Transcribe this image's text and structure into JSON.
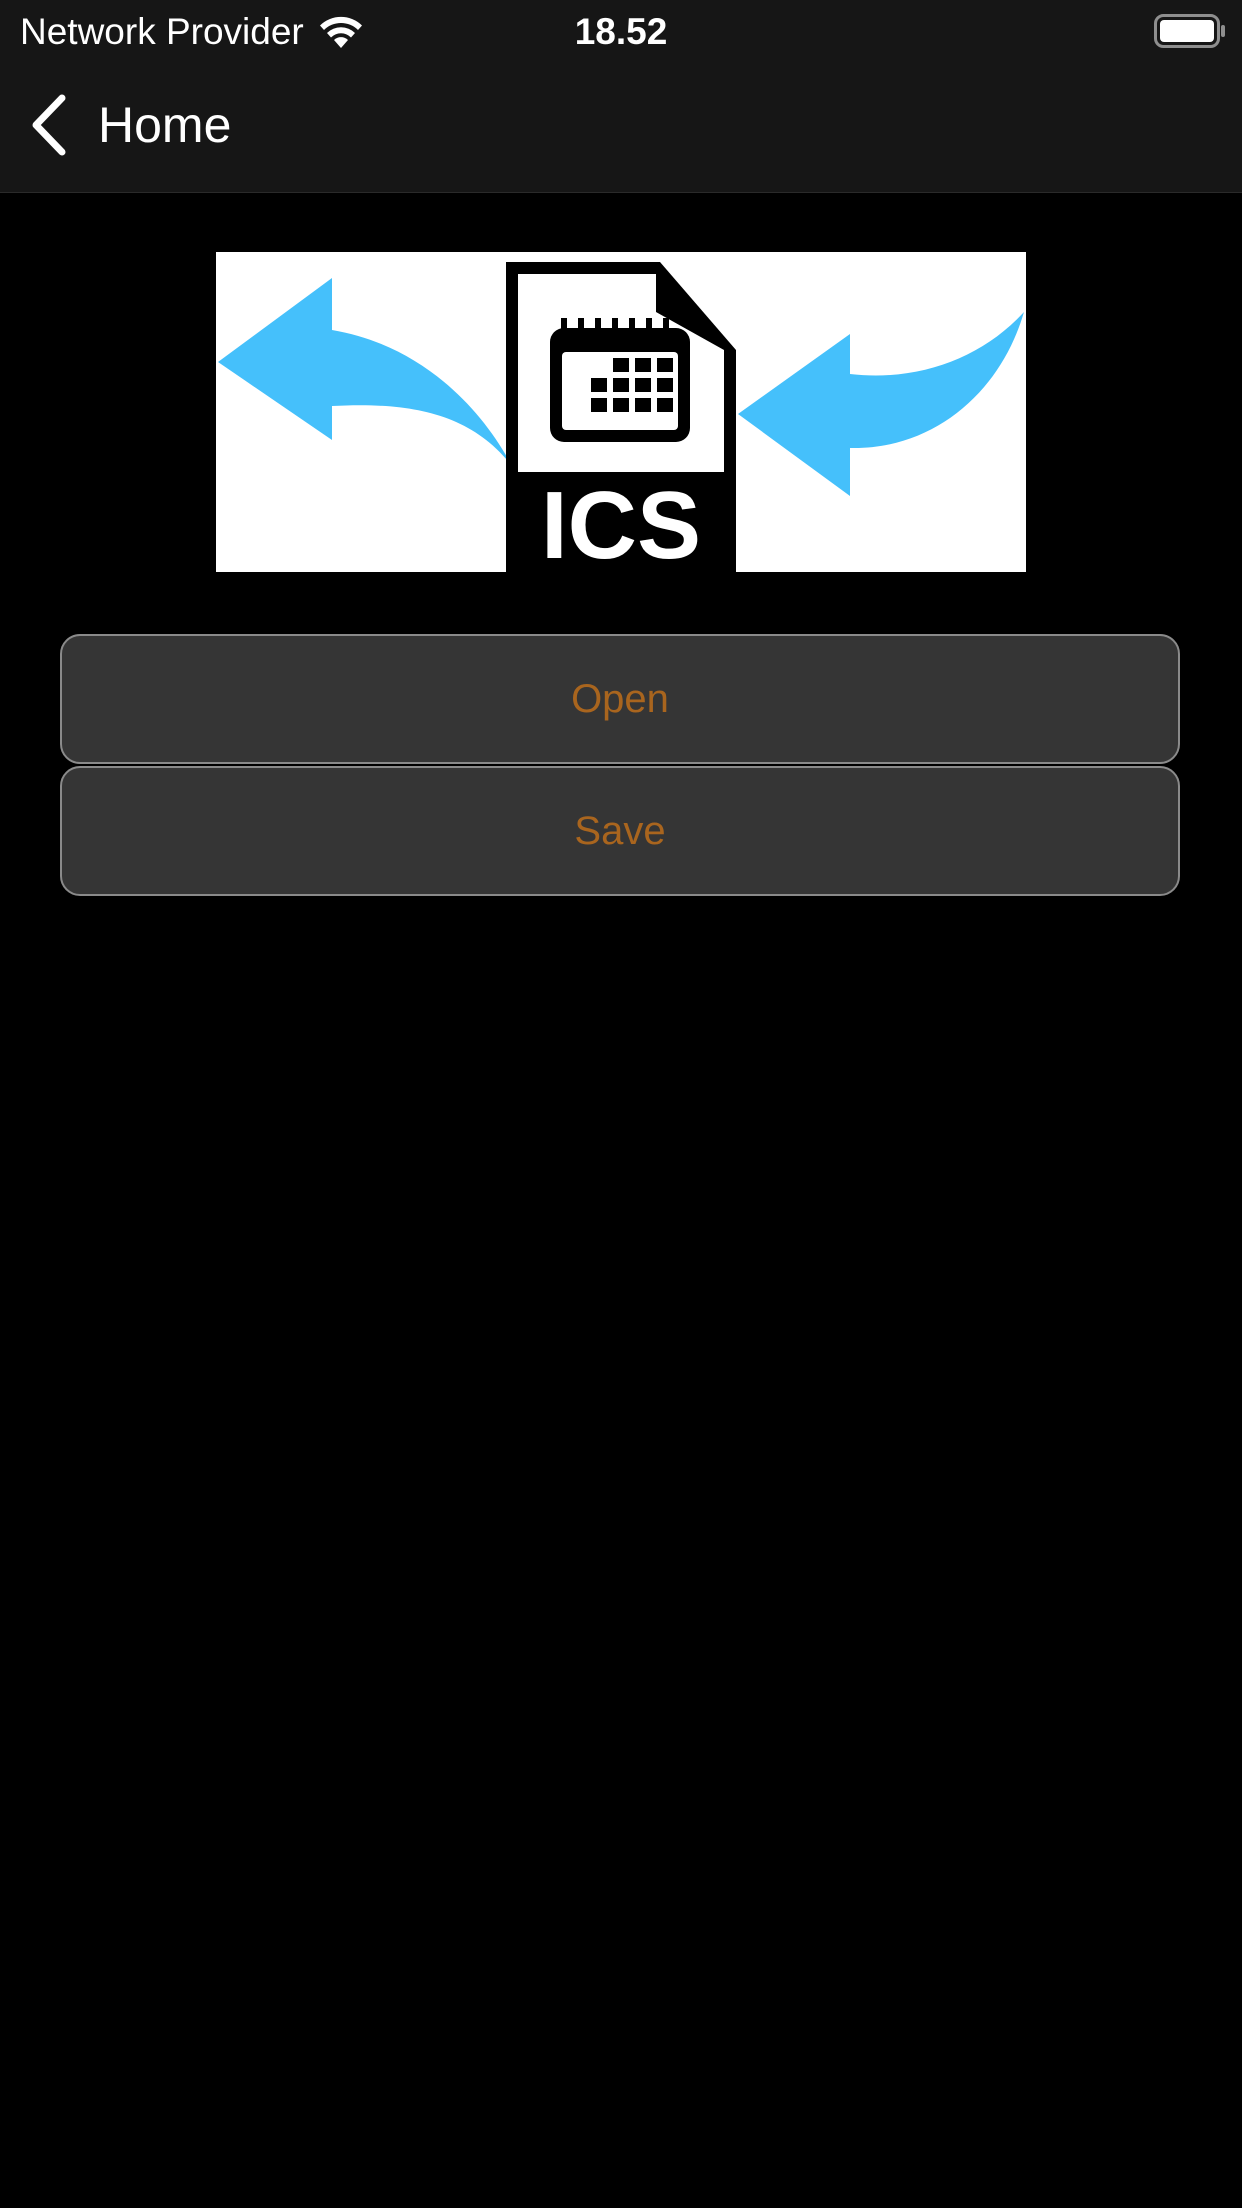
{
  "status_bar": {
    "carrier": "Network Provider",
    "time": "18.52",
    "wifi_icon": "wifi-icon",
    "battery_icon": "battery-icon"
  },
  "nav": {
    "back_label": "Home",
    "back_icon": "chevron-left-icon"
  },
  "hero": {
    "icon": "ics-file-import-export-icon",
    "file_label": "ICS",
    "arrow_color": "#45c0fb"
  },
  "actions": {
    "open_label": "Open",
    "save_label": "Save"
  },
  "colors": {
    "background": "#000000",
    "bar_background": "#161616",
    "button_background": "#353535",
    "button_text": "#a9651e"
  }
}
